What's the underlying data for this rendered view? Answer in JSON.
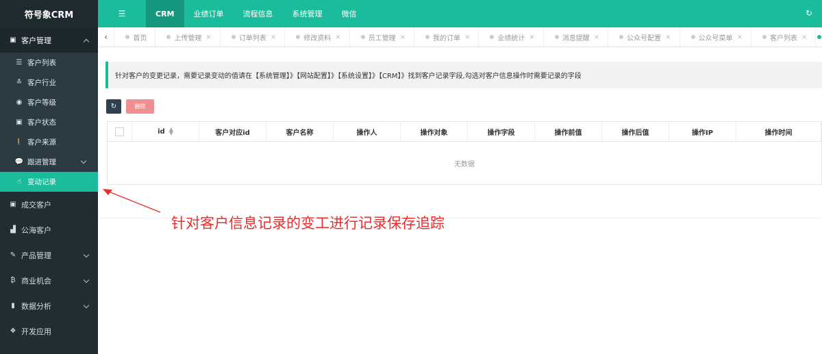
{
  "app": {
    "logo": "符号象CRM"
  },
  "sidebar": {
    "groups": [
      {
        "label": "客户管理",
        "icon": "id-card-icon",
        "glyph": "▣",
        "expanded": true
      },
      {
        "label": "成交客户",
        "icon": "id-card-icon",
        "glyph": "▣"
      },
      {
        "label": "公海客户",
        "icon": "factory-icon",
        "glyph": "▟"
      },
      {
        "label": "产品管理",
        "icon": "brush-icon",
        "glyph": "✎"
      },
      {
        "label": "商业机会",
        "icon": "bitcoin-icon",
        "glyph": "₿"
      },
      {
        "label": "数据分析",
        "icon": "bar-chart-icon",
        "glyph": "▮"
      },
      {
        "label": "开发应用",
        "icon": "cubes-icon",
        "glyph": "❖"
      }
    ],
    "sub_items": [
      {
        "label": "客户列表",
        "icon": "list-icon",
        "glyph": "☰"
      },
      {
        "label": "客户行业",
        "icon": "industry-icon",
        "glyph": "≛"
      },
      {
        "label": "客户等级",
        "icon": "compass-icon",
        "glyph": "◉"
      },
      {
        "label": "客户状态",
        "icon": "id-card-icon",
        "glyph": "▣"
      },
      {
        "label": "客户来源",
        "icon": "walking-icon",
        "glyph": "🚶"
      },
      {
        "label": "跟进管理",
        "icon": "comment-icon",
        "glyph": "💬"
      },
      {
        "label": "变动记录",
        "icon": "hand-pointer-icon",
        "glyph": "☝"
      }
    ]
  },
  "topbar": {
    "menu_icon": "☰",
    "nav": [
      "CRM",
      "业绩订单",
      "流程信息",
      "系统管理",
      "微信"
    ],
    "refresh_icon": "↻"
  },
  "tabs": [
    "首页",
    "上传管理",
    "订单列表",
    "修改资料",
    "员工管理",
    "我的订单",
    "业绩统计",
    "消息提醒",
    "公众号配置",
    "公众号菜单",
    "客户列表"
  ],
  "content": {
    "notice": "针对客户的变更记录，需要记录变动的值请在【系统管理】》【网站配置】》【系统设置】》【CRM】》找到客户记录字段,勾选对客户信息操作时需要记录的字段",
    "toolbar": {
      "refresh_icon": "↻",
      "delete_label": "删除"
    },
    "table": {
      "columns": [
        "id",
        "客户对应id",
        "客户名称",
        "操作人",
        "操作对象",
        "操作字段",
        "操作前值",
        "操作后值",
        "操作IP",
        "操作时间"
      ],
      "empty": "无数据"
    }
  },
  "annotation": {
    "text": "针对客户信息记录的变工进行记录保存追踪",
    "color": "#ec2c2c"
  },
  "colors": {
    "accent": "#1abc9c",
    "sidebar": "#222d32",
    "delete": "#f08f91"
  }
}
